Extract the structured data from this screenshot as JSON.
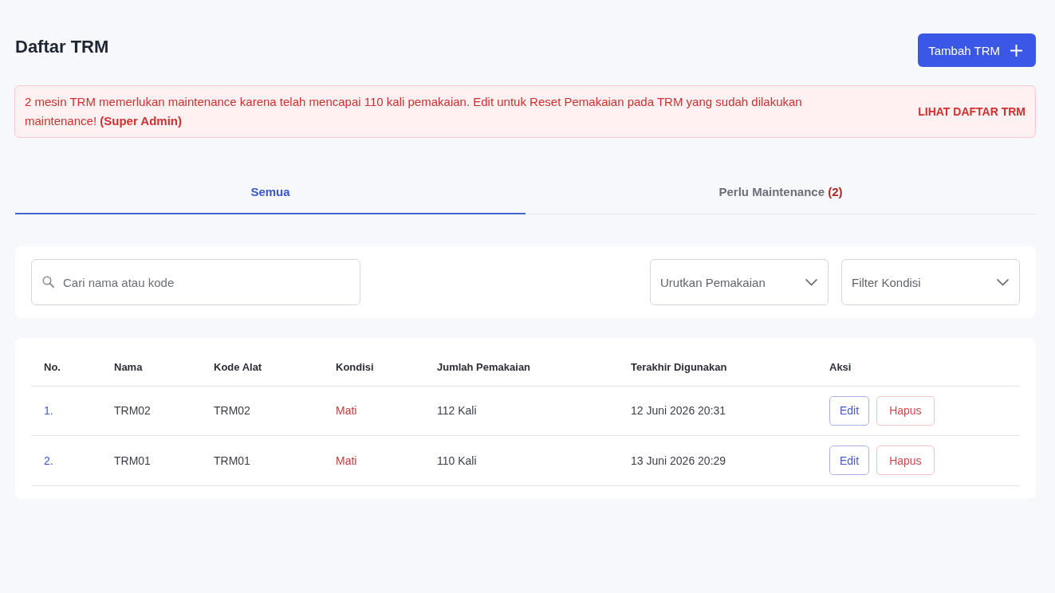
{
  "header": {
    "title": "Daftar TRM",
    "add_button": "Tambah TRM"
  },
  "alert": {
    "message": "2 mesin TRM memerlukan maintenance karena telah mencapai 110 kali pemakaian. Edit untuk Reset Pemakaian pada TRM yang sudah dilakukan maintenance! **(Super Admin)**",
    "link": "LIHAT DAFTAR TRM"
  },
  "tabs": [
    {
      "label": "Semua",
      "selected": true
    },
    {
      "label": "Perlu Maintenance",
      "count": "(2)",
      "selected": false
    }
  ],
  "filters": {
    "search": {
      "placeholder": "Cari nama atau kode"
    },
    "dropdowns": [
      {
        "placeholder": "Urutkan Pemakaian"
      },
      {
        "placeholder": "Filter Kondisi"
      }
    ]
  },
  "table": {
    "columns": [
      "No.",
      "Nama",
      "Kode Alat",
      "Kondisi",
      "Jumlah Pemakaian",
      "Terakhir Digunakan",
      "Aksi"
    ],
    "rows": [
      {
        "no": "1.",
        "nama": "TRM02",
        "kode_alat": "TRM02",
        "kondisi": "Mati",
        "jumlah_pemakaian": "112 Kali",
        "terakhir_digunakan": "12 Juni 2026 20:31",
        "actions": [
          {
            "label": "Edit",
            "kind": "edit"
          },
          {
            "label": "Hapus",
            "kind": "delete"
          }
        ]
      },
      {
        "no": "2.",
        "nama": "TRM01",
        "kode_alat": "TRM01",
        "kondisi": "Mati",
        "jumlah_pemakaian": "110 Kali",
        "terakhir_digunakan": "13 Juni 2026 20:29",
        "actions": [
          {
            "label": "Edit",
            "kind": "edit"
          },
          {
            "label": "Hapus",
            "kind": "delete"
          }
        ]
      }
    ]
  }
}
